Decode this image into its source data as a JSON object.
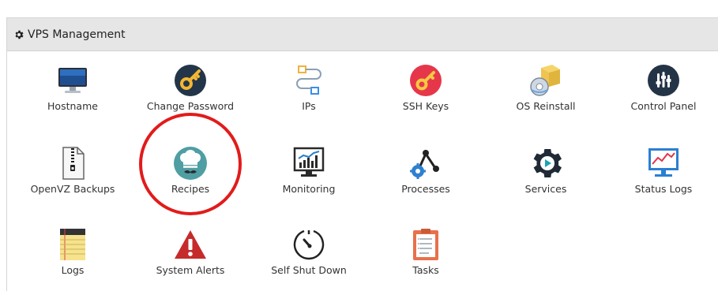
{
  "panel": {
    "title": "VPS Management",
    "title_icon": "gear-icon"
  },
  "tiles": [
    {
      "label": "Hostname",
      "icon": "monitor-icon"
    },
    {
      "label": "Change Password",
      "icon": "key-icon"
    },
    {
      "label": "IPs",
      "icon": "network-icon"
    },
    {
      "label": "SSH Keys",
      "icon": "key-icon"
    },
    {
      "label": "OS Reinstall",
      "icon": "package-icon"
    },
    {
      "label": "Control Panel",
      "icon": "control-panel-icon"
    },
    {
      "label": "OpenVZ Backups",
      "icon": "zip-file-icon"
    },
    {
      "label": "Recipes",
      "icon": "chef-icon"
    },
    {
      "label": "Monitoring",
      "icon": "chart-monitor-icon"
    },
    {
      "label": "Processes",
      "icon": "processes-icon"
    },
    {
      "label": "Services",
      "icon": "services-icon"
    },
    {
      "label": "Status Logs",
      "icon": "status-logs-icon"
    },
    {
      "label": "Logs",
      "icon": "notepad-icon"
    },
    {
      "label": "System Alerts",
      "icon": "warning-icon"
    },
    {
      "label": "Self Shut Down",
      "icon": "timer-icon"
    },
    {
      "label": "Tasks",
      "icon": "clipboard-icon"
    }
  ],
  "annotation": {
    "highlight_color": "#e21b1b",
    "highlighted_tile": "Recipes"
  },
  "colors": {
    "header_bg": "#e6e6e6",
    "text": "#333333"
  }
}
